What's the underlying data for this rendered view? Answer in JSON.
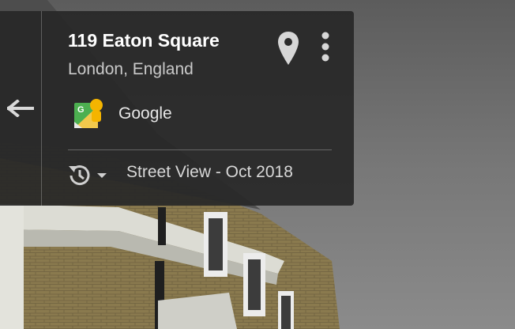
{
  "place": {
    "title": "119 Eaton Square",
    "subtitle": "London, England"
  },
  "provider": {
    "name": "Google",
    "icon": "google-street-view-icon"
  },
  "imagery": {
    "date_label": "Street View - Oct 2018"
  },
  "icons": {
    "back": "back-arrow-icon",
    "pin": "map-pin-icon",
    "more": "more-vertical-icon",
    "history": "history-clock-icon",
    "dropdown": "caret-down-icon"
  },
  "colors": {
    "panel_bg": "#282828",
    "title_text": "#ffffff",
    "secondary_text": "#c9c9c9"
  }
}
